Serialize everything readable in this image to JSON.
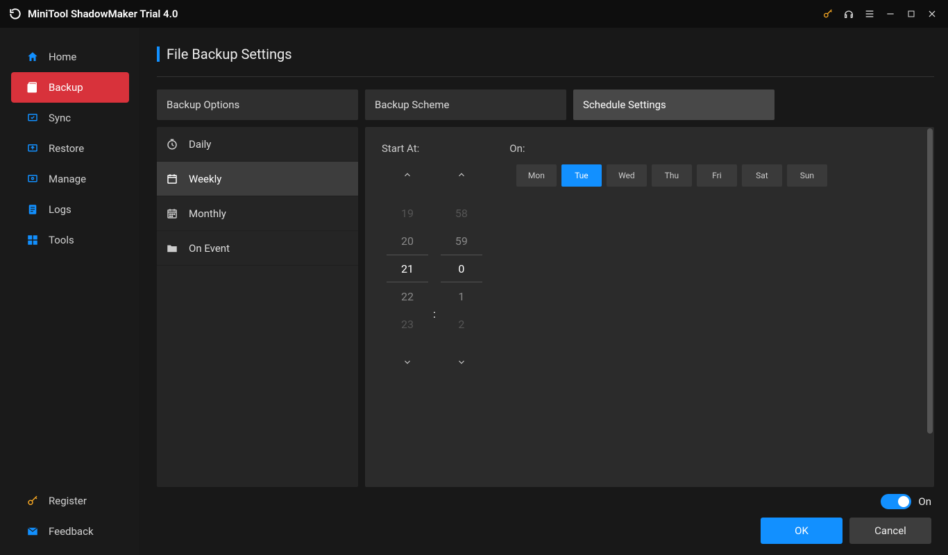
{
  "title": "MiniTool ShadowMaker Trial 4.0",
  "sidebar": {
    "items": [
      {
        "label": "Home",
        "icon": "home"
      },
      {
        "label": "Backup",
        "icon": "backup"
      },
      {
        "label": "Sync",
        "icon": "sync"
      },
      {
        "label": "Restore",
        "icon": "restore"
      },
      {
        "label": "Manage",
        "icon": "manage"
      },
      {
        "label": "Logs",
        "icon": "logs"
      },
      {
        "label": "Tools",
        "icon": "tools"
      }
    ],
    "active_index": 1,
    "footer": [
      {
        "label": "Register",
        "icon": "key"
      },
      {
        "label": "Feedback",
        "icon": "mail"
      }
    ]
  },
  "page": {
    "heading": "File Backup Settings",
    "tabs": [
      {
        "label": "Backup Options"
      },
      {
        "label": "Backup Scheme"
      },
      {
        "label": "Schedule Settings"
      }
    ],
    "active_tab": 2,
    "options": [
      {
        "label": "Daily",
        "icon": "clock"
      },
      {
        "label": "Weekly",
        "icon": "calendar"
      },
      {
        "label": "Monthly",
        "icon": "calendar-grid"
      },
      {
        "label": "On Event",
        "icon": "folder"
      }
    ],
    "active_option": 1,
    "panel": {
      "start_label": "Start At:",
      "on_label": "On:",
      "hours": [
        "19",
        "20",
        "21",
        "22",
        "23"
      ],
      "minutes": [
        "58",
        "59",
        "0",
        "1",
        "2"
      ],
      "colon": ":",
      "days": [
        "Mon",
        "Tue",
        "Wed",
        "Thu",
        "Fri",
        "Sat",
        "Sun"
      ],
      "active_day_index": 1
    }
  },
  "bottom": {
    "toggle_label": "On",
    "toggle_state": true,
    "ok": "OK",
    "cancel": "Cancel"
  }
}
